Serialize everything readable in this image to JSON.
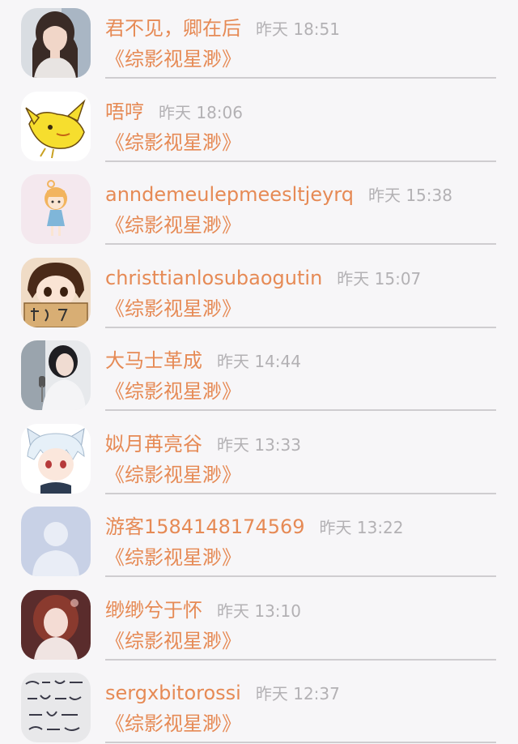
{
  "comments": [
    {
      "name": "君不见，卿在后",
      "time": "昨天 18:51",
      "book": "《综影视星渺》",
      "avatar": "user-photo-avatar"
    },
    {
      "name": "唔哼",
      "time": "昨天 18:06",
      "book": "《综影视星渺》",
      "avatar": "yellow-bird-avatar"
    },
    {
      "name": "anndemeulepmeesltjeyrq",
      "time": "昨天 15:38",
      "book": "《综影视星渺》",
      "avatar": "cartoon-girl-avatar"
    },
    {
      "name": "christtianlosubaogutin",
      "time": "昨天 15:07",
      "book": "《综影视星渺》",
      "avatar": "anime-girl-box-avatar"
    },
    {
      "name": "大马士革成",
      "time": "昨天 14:44",
      "book": "《综影视星渺》",
      "avatar": "singer-photo-avatar"
    },
    {
      "name": "姒月苒亮谷",
      "time": "昨天 13:33",
      "book": "《综影视星渺》",
      "avatar": "anime-cat-boy-avatar"
    },
    {
      "name": "游客1584148174569",
      "time": "昨天 13:22",
      "book": "《综影视星渺》",
      "avatar": "default-user-avatar"
    },
    {
      "name": "缈缈兮于怀",
      "time": "昨天 13:10",
      "book": "《综影视星渺》",
      "avatar": "red-hair-girl-avatar"
    },
    {
      "name": "sergxbitorossi",
      "time": "昨天 12:37",
      "book": "《综影视星渺》",
      "avatar": "handwriting-note-avatar"
    }
  ]
}
